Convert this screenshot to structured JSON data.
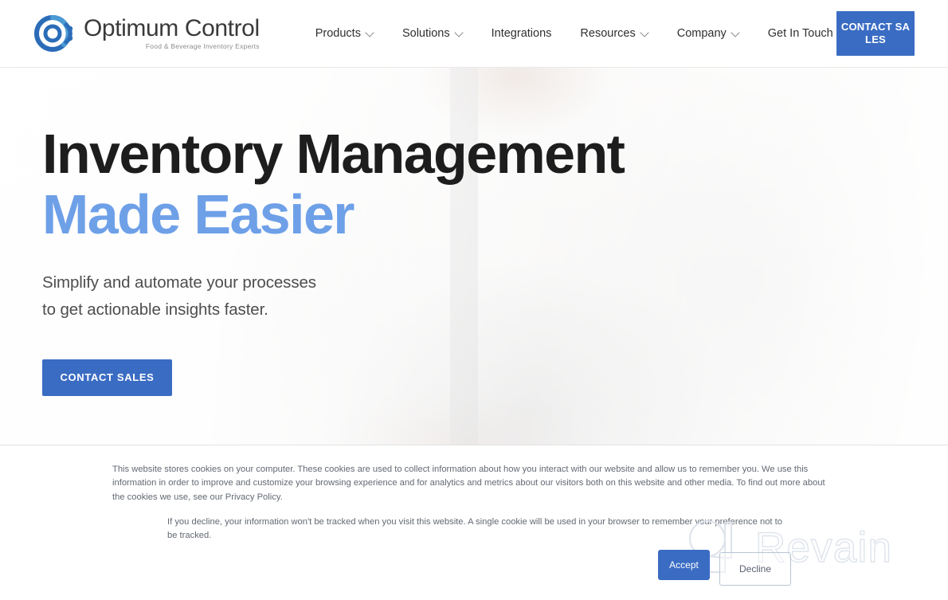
{
  "header": {
    "logo": {
      "wordmark": "Optimum Control",
      "tagline": "Food & Beverage Inventory Experts",
      "mark_icon": "optimum-control-logo-icon",
      "brand_color": "#2b6cb8"
    },
    "nav_items": [
      {
        "label": "Products",
        "has_dropdown": true
      },
      {
        "label": "Solutions",
        "has_dropdown": true
      },
      {
        "label": "Integrations",
        "has_dropdown": false
      },
      {
        "label": "Resources",
        "has_dropdown": true
      },
      {
        "label": "Company",
        "has_dropdown": true
      },
      {
        "label": "Get In Touch",
        "has_dropdown": true
      }
    ],
    "cta_label": "CONTACT SALES",
    "cta_color": "#3a6cc3"
  },
  "hero": {
    "heading_line1": "Inventory Management",
    "heading_line2": "Made Easier",
    "heading_color": "#1d1d1d",
    "accent_color": "#6ea0e8",
    "subheading_line1": "Simplify and automate your processes",
    "subheading_line2": "to get actionable insights faster.",
    "cta_label": "CONTACT SALES",
    "cta_color": "#3a6cc3",
    "background_image_alt": "chef in white shirt and apron, faded"
  },
  "cookie_banner": {
    "paragraph1": "This website stores cookies on your computer. These cookies are used to collect information about how you interact with our website and allow us to remember you. We use this information in order to improve and customize your browsing experience and for analytics and metrics about our visitors both on this website and other media. To find out more about the cookies we use, see our Privacy Policy.",
    "paragraph2": "If you decline, your information won't be tracked when you visit this website. A single cookie will be used in your browser to remember your preference not to be tracked.",
    "accept_label": "Accept",
    "decline_label": "Decline",
    "accept_color": "#3a6cc3"
  },
  "watermark": {
    "text": "Revain",
    "mark_icon": "revain-logo-icon"
  }
}
